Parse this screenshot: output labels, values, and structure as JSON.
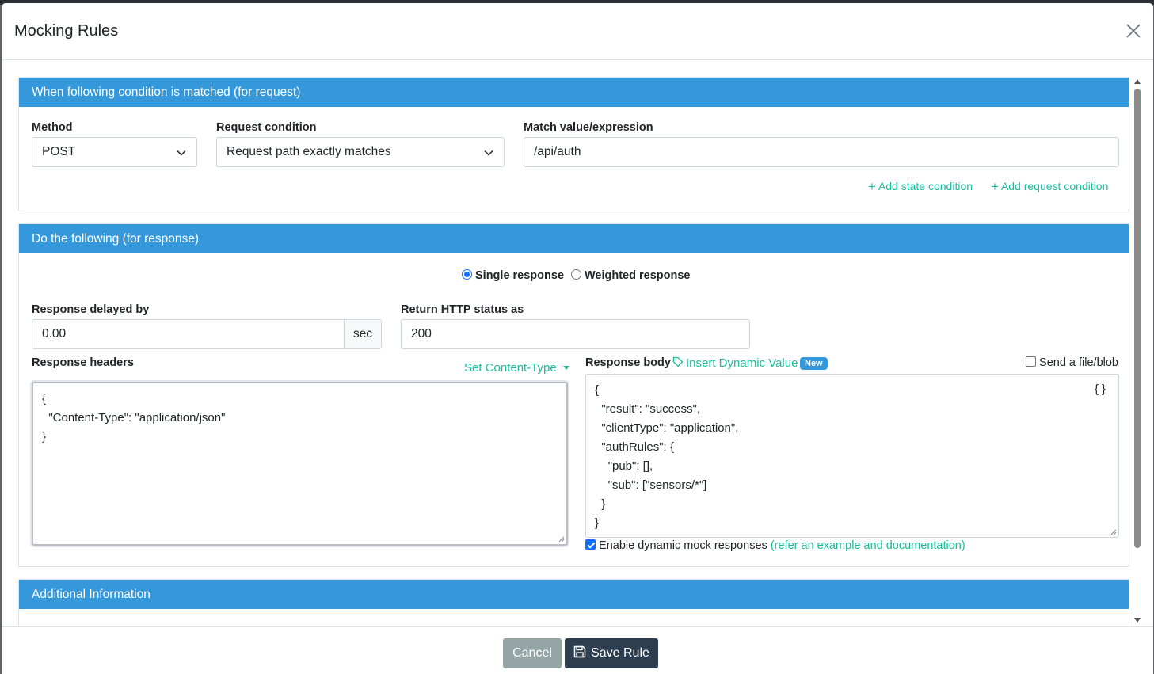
{
  "modal": {
    "title": "Mocking Rules"
  },
  "request_card": {
    "header": "When following condition is matched (for request)",
    "method_label": "Method",
    "method_value": "POST",
    "condition_label": "Request condition",
    "condition_value": "Request path exactly matches",
    "match_label": "Match value/expression",
    "match_value": "/api/auth",
    "add_state_condition": "Add state condition",
    "add_request_condition": "Add request condition"
  },
  "response_card": {
    "header": "Do the following (for response)",
    "single_response": "Single response",
    "weighted_response": "Weighted response",
    "delay_label": "Response delayed by",
    "delay_value": "0.00",
    "delay_unit": "sec",
    "status_label": "Return HTTP status as",
    "status_value": "200",
    "headers_label": "Response headers",
    "set_content_type": "Set Content-Type",
    "headers_code": "{\n  \"Content-Type\": \"application/json\"\n}",
    "body_label": "Response body",
    "insert_dynamic_value": "Insert Dynamic Value",
    "new_badge": "New",
    "send_file_blob": "Send a file/blob",
    "format_json": "{ }",
    "body_code": "{\n  \"result\": \"success\",\n  \"clientType\": \"application\",\n  \"authRules\": {\n    \"pub\": [],\n    \"sub\": [\"sensors/*\"]\n  }\n}",
    "enable_dynamic": "Enable dynamic mock responses",
    "enable_dynamic_link": "(refer an example and documentation)"
  },
  "additional_card": {
    "header": "Additional Information"
  },
  "footer": {
    "cancel": "Cancel",
    "save": "Save Rule"
  },
  "colors": {
    "card_header": "#3498db",
    "link": "#1abc9c",
    "cancel_button": "#95a5a6",
    "save_button": "#2c3e50",
    "checkbox": "#0d6efd"
  },
  "icons": {
    "close": "close-icon",
    "chevron": "chevron-down-icon",
    "tag": "tag-icon",
    "save": "floppy-disk-icon"
  }
}
